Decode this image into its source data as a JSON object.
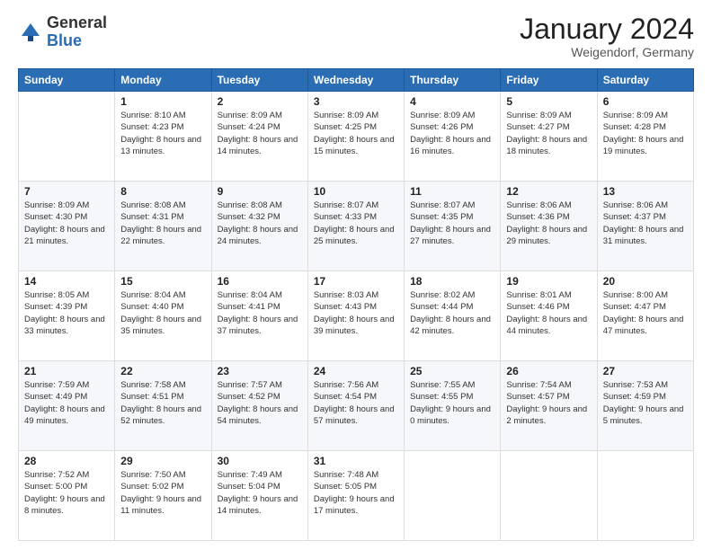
{
  "logo": {
    "general": "General",
    "blue": "Blue"
  },
  "header": {
    "month": "January 2024",
    "location": "Weigendorf, Germany"
  },
  "weekdays": [
    "Sunday",
    "Monday",
    "Tuesday",
    "Wednesday",
    "Thursday",
    "Friday",
    "Saturday"
  ],
  "weeks": [
    [
      {
        "day": "",
        "sunrise": "",
        "sunset": "",
        "daylight": ""
      },
      {
        "day": "1",
        "sunrise": "Sunrise: 8:10 AM",
        "sunset": "Sunset: 4:23 PM",
        "daylight": "Daylight: 8 hours and 13 minutes."
      },
      {
        "day": "2",
        "sunrise": "Sunrise: 8:09 AM",
        "sunset": "Sunset: 4:24 PM",
        "daylight": "Daylight: 8 hours and 14 minutes."
      },
      {
        "day": "3",
        "sunrise": "Sunrise: 8:09 AM",
        "sunset": "Sunset: 4:25 PM",
        "daylight": "Daylight: 8 hours and 15 minutes."
      },
      {
        "day": "4",
        "sunrise": "Sunrise: 8:09 AM",
        "sunset": "Sunset: 4:26 PM",
        "daylight": "Daylight: 8 hours and 16 minutes."
      },
      {
        "day": "5",
        "sunrise": "Sunrise: 8:09 AM",
        "sunset": "Sunset: 4:27 PM",
        "daylight": "Daylight: 8 hours and 18 minutes."
      },
      {
        "day": "6",
        "sunrise": "Sunrise: 8:09 AM",
        "sunset": "Sunset: 4:28 PM",
        "daylight": "Daylight: 8 hours and 19 minutes."
      }
    ],
    [
      {
        "day": "7",
        "sunrise": "Sunrise: 8:09 AM",
        "sunset": "Sunset: 4:30 PM",
        "daylight": "Daylight: 8 hours and 21 minutes."
      },
      {
        "day": "8",
        "sunrise": "Sunrise: 8:08 AM",
        "sunset": "Sunset: 4:31 PM",
        "daylight": "Daylight: 8 hours and 22 minutes."
      },
      {
        "day": "9",
        "sunrise": "Sunrise: 8:08 AM",
        "sunset": "Sunset: 4:32 PM",
        "daylight": "Daylight: 8 hours and 24 minutes."
      },
      {
        "day": "10",
        "sunrise": "Sunrise: 8:07 AM",
        "sunset": "Sunset: 4:33 PM",
        "daylight": "Daylight: 8 hours and 25 minutes."
      },
      {
        "day": "11",
        "sunrise": "Sunrise: 8:07 AM",
        "sunset": "Sunset: 4:35 PM",
        "daylight": "Daylight: 8 hours and 27 minutes."
      },
      {
        "day": "12",
        "sunrise": "Sunrise: 8:06 AM",
        "sunset": "Sunset: 4:36 PM",
        "daylight": "Daylight: 8 hours and 29 minutes."
      },
      {
        "day": "13",
        "sunrise": "Sunrise: 8:06 AM",
        "sunset": "Sunset: 4:37 PM",
        "daylight": "Daylight: 8 hours and 31 minutes."
      }
    ],
    [
      {
        "day": "14",
        "sunrise": "Sunrise: 8:05 AM",
        "sunset": "Sunset: 4:39 PM",
        "daylight": "Daylight: 8 hours and 33 minutes."
      },
      {
        "day": "15",
        "sunrise": "Sunrise: 8:04 AM",
        "sunset": "Sunset: 4:40 PM",
        "daylight": "Daylight: 8 hours and 35 minutes."
      },
      {
        "day": "16",
        "sunrise": "Sunrise: 8:04 AM",
        "sunset": "Sunset: 4:41 PM",
        "daylight": "Daylight: 8 hours and 37 minutes."
      },
      {
        "day": "17",
        "sunrise": "Sunrise: 8:03 AM",
        "sunset": "Sunset: 4:43 PM",
        "daylight": "Daylight: 8 hours and 39 minutes."
      },
      {
        "day": "18",
        "sunrise": "Sunrise: 8:02 AM",
        "sunset": "Sunset: 4:44 PM",
        "daylight": "Daylight: 8 hours and 42 minutes."
      },
      {
        "day": "19",
        "sunrise": "Sunrise: 8:01 AM",
        "sunset": "Sunset: 4:46 PM",
        "daylight": "Daylight: 8 hours and 44 minutes."
      },
      {
        "day": "20",
        "sunrise": "Sunrise: 8:00 AM",
        "sunset": "Sunset: 4:47 PM",
        "daylight": "Daylight: 8 hours and 47 minutes."
      }
    ],
    [
      {
        "day": "21",
        "sunrise": "Sunrise: 7:59 AM",
        "sunset": "Sunset: 4:49 PM",
        "daylight": "Daylight: 8 hours and 49 minutes."
      },
      {
        "day": "22",
        "sunrise": "Sunrise: 7:58 AM",
        "sunset": "Sunset: 4:51 PM",
        "daylight": "Daylight: 8 hours and 52 minutes."
      },
      {
        "day": "23",
        "sunrise": "Sunrise: 7:57 AM",
        "sunset": "Sunset: 4:52 PM",
        "daylight": "Daylight: 8 hours and 54 minutes."
      },
      {
        "day": "24",
        "sunrise": "Sunrise: 7:56 AM",
        "sunset": "Sunset: 4:54 PM",
        "daylight": "Daylight: 8 hours and 57 minutes."
      },
      {
        "day": "25",
        "sunrise": "Sunrise: 7:55 AM",
        "sunset": "Sunset: 4:55 PM",
        "daylight": "Daylight: 9 hours and 0 minutes."
      },
      {
        "day": "26",
        "sunrise": "Sunrise: 7:54 AM",
        "sunset": "Sunset: 4:57 PM",
        "daylight": "Daylight: 9 hours and 2 minutes."
      },
      {
        "day": "27",
        "sunrise": "Sunrise: 7:53 AM",
        "sunset": "Sunset: 4:59 PM",
        "daylight": "Daylight: 9 hours and 5 minutes."
      }
    ],
    [
      {
        "day": "28",
        "sunrise": "Sunrise: 7:52 AM",
        "sunset": "Sunset: 5:00 PM",
        "daylight": "Daylight: 9 hours and 8 minutes."
      },
      {
        "day": "29",
        "sunrise": "Sunrise: 7:50 AM",
        "sunset": "Sunset: 5:02 PM",
        "daylight": "Daylight: 9 hours and 11 minutes."
      },
      {
        "day": "30",
        "sunrise": "Sunrise: 7:49 AM",
        "sunset": "Sunset: 5:04 PM",
        "daylight": "Daylight: 9 hours and 14 minutes."
      },
      {
        "day": "31",
        "sunrise": "Sunrise: 7:48 AM",
        "sunset": "Sunset: 5:05 PM",
        "daylight": "Daylight: 9 hours and 17 minutes."
      },
      {
        "day": "",
        "sunrise": "",
        "sunset": "",
        "daylight": ""
      },
      {
        "day": "",
        "sunrise": "",
        "sunset": "",
        "daylight": ""
      },
      {
        "day": "",
        "sunrise": "",
        "sunset": "",
        "daylight": ""
      }
    ]
  ]
}
